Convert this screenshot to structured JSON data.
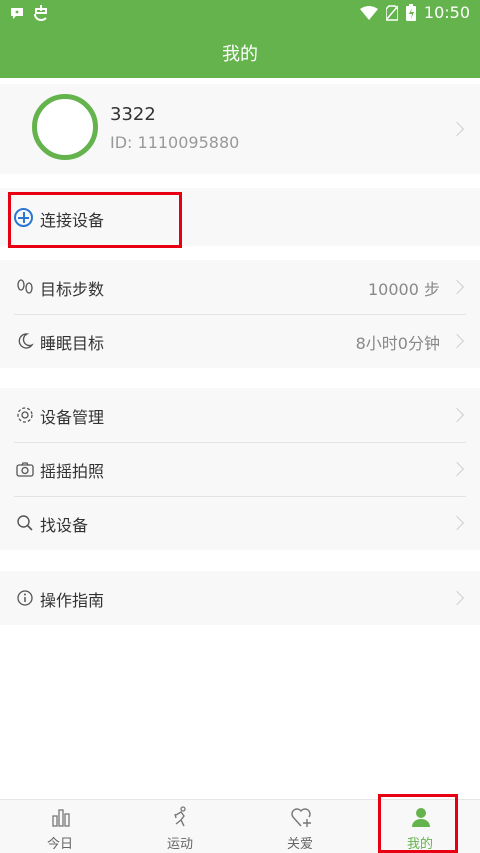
{
  "status_bar": {
    "time": "10:50",
    "icons": [
      "notification-icon",
      "app-icon",
      "wifi-icon",
      "no-sim-icon",
      "battery-icon"
    ]
  },
  "app_bar": {
    "title": "我的"
  },
  "profile": {
    "name": "3322",
    "id_text": "ID: 1110095880"
  },
  "connect": {
    "label": "连接设备",
    "icon": "plus-circle-icon"
  },
  "goals": [
    {
      "label": "目标步数",
      "value": "10000 步",
      "icon": "footprints-icon"
    },
    {
      "label": "睡眠目标",
      "value": "8小时0分钟",
      "icon": "moon-icon"
    }
  ],
  "device": [
    {
      "label": "设备管理",
      "icon": "gear-icon"
    },
    {
      "label": "摇摇拍照",
      "icon": "camera-icon"
    },
    {
      "label": "找设备",
      "icon": "search-icon"
    }
  ],
  "guide": {
    "label": "操作指南",
    "icon": "info-icon"
  },
  "tabs": [
    {
      "label": "今日",
      "icon": "bar-chart-icon"
    },
    {
      "label": "运动",
      "icon": "running-icon"
    },
    {
      "label": "关爱",
      "icon": "heart-plus-icon"
    },
    {
      "label": "我的",
      "icon": "person-icon",
      "active": true
    }
  ],
  "colors": {
    "brand_green": "#64b34c",
    "highlight_red": "#e60012",
    "link_blue": "#2a76d2"
  }
}
